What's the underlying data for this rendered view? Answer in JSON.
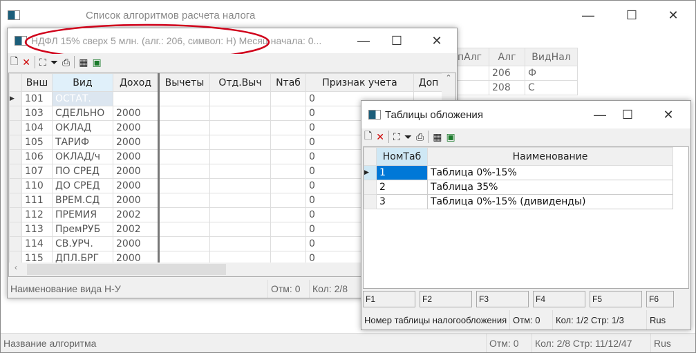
{
  "main": {
    "title": "Список алгоритмов расчета налога",
    "columns": [
      "пАлг",
      "Алг",
      "ВидНал"
    ],
    "rows": [
      [
        "",
        "206",
        "Ф"
      ],
      [
        "",
        "208",
        "С"
      ]
    ],
    "status": {
      "hint": "Название алгоритма",
      "marked": "Отм: 0",
      "position": "Кол: 2/8  Стр: 11/12/47",
      "lang": "Rus"
    }
  },
  "win1": {
    "title": "НДФЛ 15% сверх 5 млн. (алг.: 206, символ: Н) Месяц начала: 0...",
    "columns": [
      "Внш",
      "Вид",
      "Доход",
      "Вычеты",
      "Отд.Выч",
      "Nтаб",
      "Признак учета",
      "Доп"
    ],
    "rows": [
      [
        "101",
        "ОСТАТ.",
        "",
        "",
        "",
        "",
        "0",
        ""
      ],
      [
        "103",
        "СДЕЛЬНО",
        "2000",
        "",
        "",
        "",
        "0",
        ""
      ],
      [
        "104",
        "ОКЛАД",
        "2000",
        "",
        "",
        "",
        "0",
        ""
      ],
      [
        "105",
        "ТАРИФ",
        "2000",
        "",
        "",
        "",
        "0",
        ""
      ],
      [
        "106",
        "ОКЛАД/ч",
        "2000",
        "",
        "",
        "",
        "0",
        ""
      ],
      [
        "107",
        "ПО СРЕД",
        "2000",
        "",
        "",
        "",
        "0",
        ""
      ],
      [
        "110",
        "ДО СРЕД",
        "2000",
        "",
        "",
        "",
        "0",
        ""
      ],
      [
        "111",
        "ВРЕМ.СД",
        "2000",
        "",
        "",
        "",
        "0",
        ""
      ],
      [
        "112",
        "ПРЕМИЯ",
        "2002",
        "",
        "",
        "",
        "0",
        ""
      ],
      [
        "113",
        "ПремРУБ",
        "2002",
        "",
        "",
        "",
        "0",
        ""
      ],
      [
        "114",
        "СВ.УРЧ.",
        "2000",
        "",
        "",
        "",
        "0",
        ""
      ],
      [
        "115",
        "ДПЛ.БРГ",
        "2000",
        "",
        "",
        "",
        "0",
        ""
      ]
    ],
    "status": {
      "hint": "Наименование вида Н-У",
      "marked": "Отм: 0",
      "position": "Кол: 2/8"
    },
    "annotation_color": "#d0021b"
  },
  "win2": {
    "title": "Таблицы обложения",
    "columns": [
      "НомТаб",
      "Наименование"
    ],
    "rows": [
      [
        "1",
        "Таблица 0%-15%"
      ],
      [
        "2",
        "Таблица 35%"
      ],
      [
        "3",
        "Таблица 0%-15% (дивиденды)"
      ]
    ],
    "fkeys": [
      "F1",
      "F2",
      "F3",
      "F4",
      "F5",
      "F6"
    ],
    "status": {
      "hint": "Номер таблицы налогообложения",
      "marked": "Отм: 0",
      "position": "Кол: 1/2  Стр: 1/3",
      "lang": "Rus"
    },
    "selection_color": "#0078d7"
  },
  "toolbar_icons": [
    "new-icon",
    "delete-icon",
    "find-icon",
    "filter-icon",
    "print-icon",
    "settings-icon",
    "excel-icon"
  ]
}
